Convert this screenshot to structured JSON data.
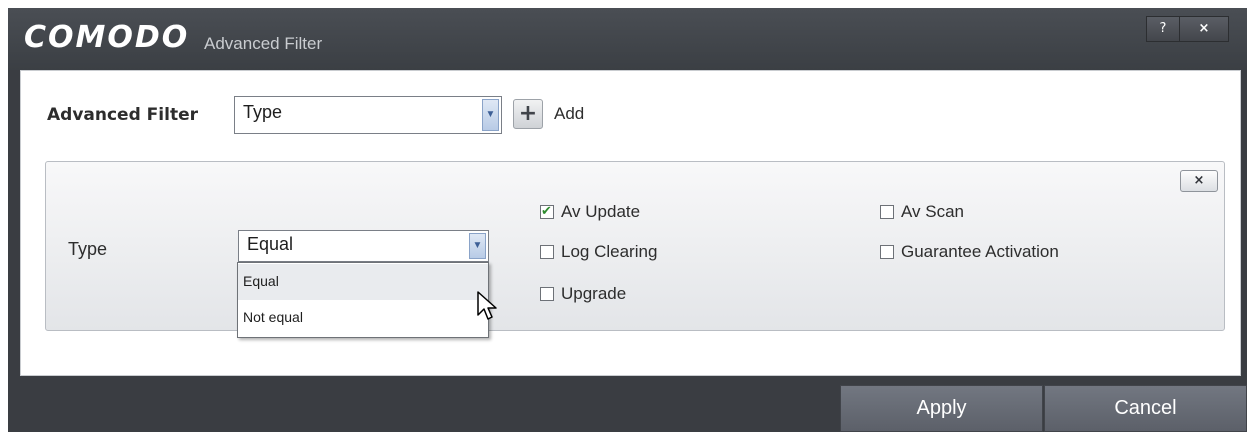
{
  "titlebar": {
    "brand": "COMODO",
    "title": "Advanced Filter",
    "help_label": "?",
    "close_label": "×"
  },
  "filter": {
    "label": "Advanced Filter",
    "selected": "Type",
    "add_label": "Add"
  },
  "panel": {
    "close_label": "×",
    "field_label": "Type",
    "operator": "Equal",
    "options": [
      {
        "label": "Av Update",
        "checked": true
      },
      {
        "label": "Av Scan",
        "checked": false
      },
      {
        "label": "Log Clearing",
        "checked": false
      },
      {
        "label": "Guarantee Activation",
        "checked": false
      },
      {
        "label": "Upgrade",
        "checked": false
      }
    ]
  },
  "dropdown": {
    "items": [
      "Equal",
      "Not equal"
    ],
    "highlighted": "Equal"
  },
  "footer": {
    "apply_label": "Apply",
    "cancel_label": "Cancel"
  },
  "colors": {
    "titlebar": "#3b3f44",
    "button": "#5c6069",
    "check": "#2e8b2e"
  }
}
